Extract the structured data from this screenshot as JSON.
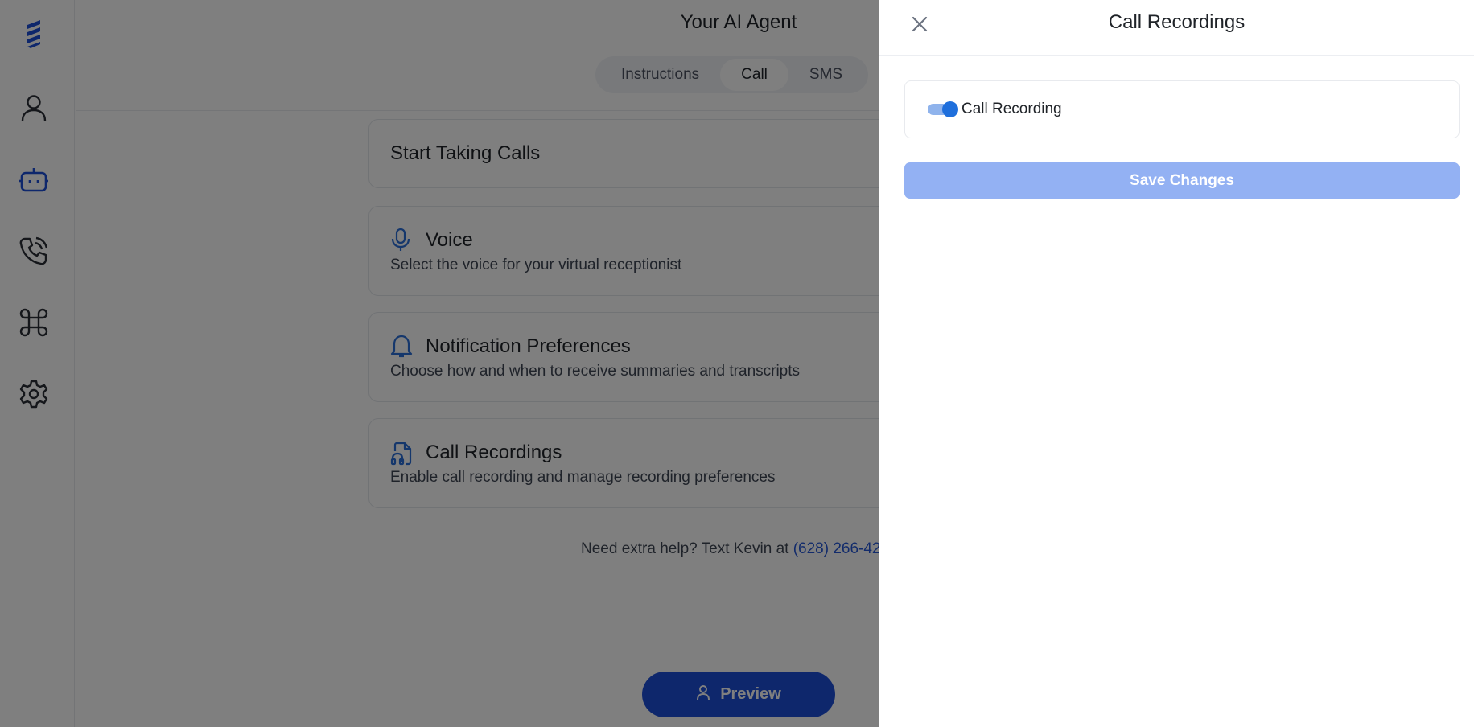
{
  "sidebar": {
    "items": [
      {
        "icon": "logo-icon"
      },
      {
        "icon": "user-icon"
      },
      {
        "icon": "robot-icon"
      },
      {
        "icon": "phone-icon"
      },
      {
        "icon": "command-icon"
      },
      {
        "icon": "gear-icon"
      }
    ]
  },
  "header": {
    "title": "Your AI Agent",
    "tabs": [
      {
        "label": "Instructions",
        "active": false
      },
      {
        "label": "Call",
        "active": true
      },
      {
        "label": "SMS",
        "active": false
      }
    ]
  },
  "cards": [
    {
      "title": "Start Taking Calls",
      "subtitle": ""
    },
    {
      "title": "Voice",
      "subtitle": "Select the voice for your virtual receptionist",
      "icon": "microphone-icon"
    },
    {
      "title": "Notification Preferences",
      "subtitle": "Choose how and when to receive summaries and transcripts",
      "icon": "bell-icon"
    },
    {
      "title": "Call Recordings",
      "subtitle": "Enable call recording and manage recording preferences",
      "icon": "recording-file-icon"
    }
  ],
  "help": {
    "text": "Need extra help? Text Kevin at",
    "phone": "(628) 266-42"
  },
  "preview_button": {
    "label": "Preview"
  },
  "drawer": {
    "title": "Call Recordings",
    "toggle_label": "Call Recording",
    "toggle_on": true,
    "save_label": "Save Changes"
  },
  "colors": {
    "accent": "#1d4fd8",
    "toggle_on": "#1f6fdc",
    "save_disabled": "#93b1f3",
    "overlay": "rgba(0,0,0,0.5)"
  }
}
